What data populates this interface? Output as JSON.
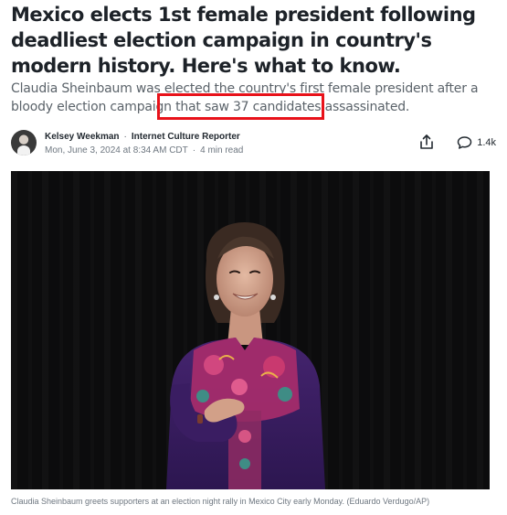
{
  "article": {
    "headline": "Mexico elects 1st female president following deadliest election campaign in country's modern history. Here's what to know.",
    "subhead_before": "Claudia Sheinbaum was elected the country's first female president after a bloody election campaign that saw ",
    "subhead_highlight": "37 candidates assassinated.",
    "highlight_color": "#e8121a"
  },
  "byline": {
    "author": "Kelsey Weekman",
    "separator": "·",
    "role": "Internet Culture Reporter",
    "date": "Mon, June 3, 2024 at 8:34 AM CDT",
    "read_time": "4 min read"
  },
  "actions": {
    "share_icon": "share-icon",
    "comment_icon": "comment-icon",
    "comment_count": "1.4k"
  },
  "photo": {
    "caption": "Claudia Sheinbaum greets supporters at an election night rally in Mexico City early Monday. (Eduardo Verdugo/AP)",
    "colors": {
      "background": "#0c0c0d",
      "dress": "#3b1f63",
      "embroidery": "#b02e6e"
    }
  }
}
